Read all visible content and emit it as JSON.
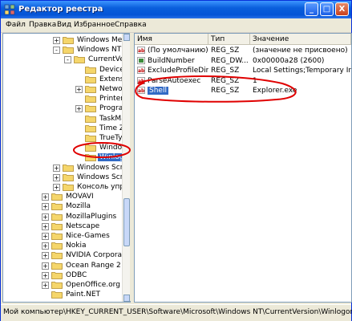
{
  "window": {
    "title": "Редактор реестра"
  },
  "titlebar_buttons": {
    "minimize": "_",
    "maximize": "□",
    "close": "X"
  },
  "menu": [
    "Файл",
    "Правка",
    "Вид",
    "Избранное",
    "Справка"
  ],
  "tree": [
    {
      "label": "Windows Media",
      "indent": 1,
      "expander": "+",
      "selected": false
    },
    {
      "label": "Windows NT",
      "indent": 1,
      "expander": "-",
      "selected": false
    },
    {
      "label": "CurrentVersi",
      "indent": 2,
      "expander": "-",
      "selected": false
    },
    {
      "label": "Devices",
      "indent": 3,
      "expander": "",
      "selected": false
    },
    {
      "label": "Extensio",
      "indent": 3,
      "expander": "",
      "selected": false
    },
    {
      "label": "Network",
      "indent": 3,
      "expander": "+",
      "selected": false
    },
    {
      "label": "PrinterP",
      "indent": 3,
      "expander": "",
      "selected": false
    },
    {
      "label": "Program",
      "indent": 3,
      "expander": "+",
      "selected": false
    },
    {
      "label": "TaskMar",
      "indent": 3,
      "expander": "",
      "selected": false
    },
    {
      "label": "Time Zo",
      "indent": 3,
      "expander": "",
      "selected": false
    },
    {
      "label": "TrueTyp",
      "indent": 3,
      "expander": "",
      "selected": false
    },
    {
      "label": "Window",
      "indent": 3,
      "expander": "",
      "selected": false
    },
    {
      "label": "Winlogo",
      "indent": 3,
      "expander": "",
      "selected": true
    },
    {
      "label": "Windows Script",
      "indent": 1,
      "expander": "+",
      "selected": false
    },
    {
      "label": "Windows Script",
      "indent": 1,
      "expander": "+",
      "selected": false
    },
    {
      "label": "Консоль управ.",
      "indent": 1,
      "expander": "+",
      "selected": false
    },
    {
      "label": "MOVAVI",
      "indent": 0,
      "expander": "+",
      "selected": false
    },
    {
      "label": "Mozilla",
      "indent": 0,
      "expander": "+",
      "selected": false
    },
    {
      "label": "MozillaPlugins",
      "indent": 0,
      "expander": "+",
      "selected": false
    },
    {
      "label": "Netscape",
      "indent": 0,
      "expander": "+",
      "selected": false
    },
    {
      "label": "Nice-Games",
      "indent": 0,
      "expander": "+",
      "selected": false
    },
    {
      "label": "Nokia",
      "indent": 0,
      "expander": "+",
      "selected": false
    },
    {
      "label": "NVIDIA Corporation",
      "indent": 0,
      "expander": "+",
      "selected": false
    },
    {
      "label": "Ocean Range 2",
      "indent": 0,
      "expander": "+",
      "selected": false
    },
    {
      "label": "ODBC",
      "indent": 0,
      "expander": "+",
      "selected": false
    },
    {
      "label": "OpenOffice.org",
      "indent": 0,
      "expander": "+",
      "selected": false
    },
    {
      "label": "Paint.NET",
      "indent": 0,
      "expander": "",
      "selected": false
    }
  ],
  "columns": {
    "name": "Имя",
    "type": "Тип",
    "value": "Значение"
  },
  "values": [
    {
      "icon": "ab",
      "name": "(По умолчанию)",
      "type": "REG_SZ",
      "value": "(значение не присвоено)"
    },
    {
      "icon": "bin",
      "name": "BuildNumber",
      "type": "REG_DW...",
      "value": "0x00000a28 (2600)"
    },
    {
      "icon": "ab",
      "name": "ExcludeProfileDirs",
      "type": "REG_SZ",
      "value": "Local Settings;Temporary Interne"
    },
    {
      "icon": "ab",
      "name": "ParseAutoexec",
      "type": "REG_SZ",
      "value": "1"
    },
    {
      "icon": "ab",
      "name": "Shell",
      "type": "REG_SZ",
      "value": "Explorer.exe",
      "selected": true
    }
  ],
  "statusbar": {
    "path": "Мой компьютер\\HKEY_CURRENT_USER\\Software\\Microsoft\\Windows NT\\CurrentVersion\\Winlogon"
  },
  "colors": {
    "selection": "#316ac5",
    "annotation": "#e00000",
    "title_bar": "#0a5fdc"
  }
}
